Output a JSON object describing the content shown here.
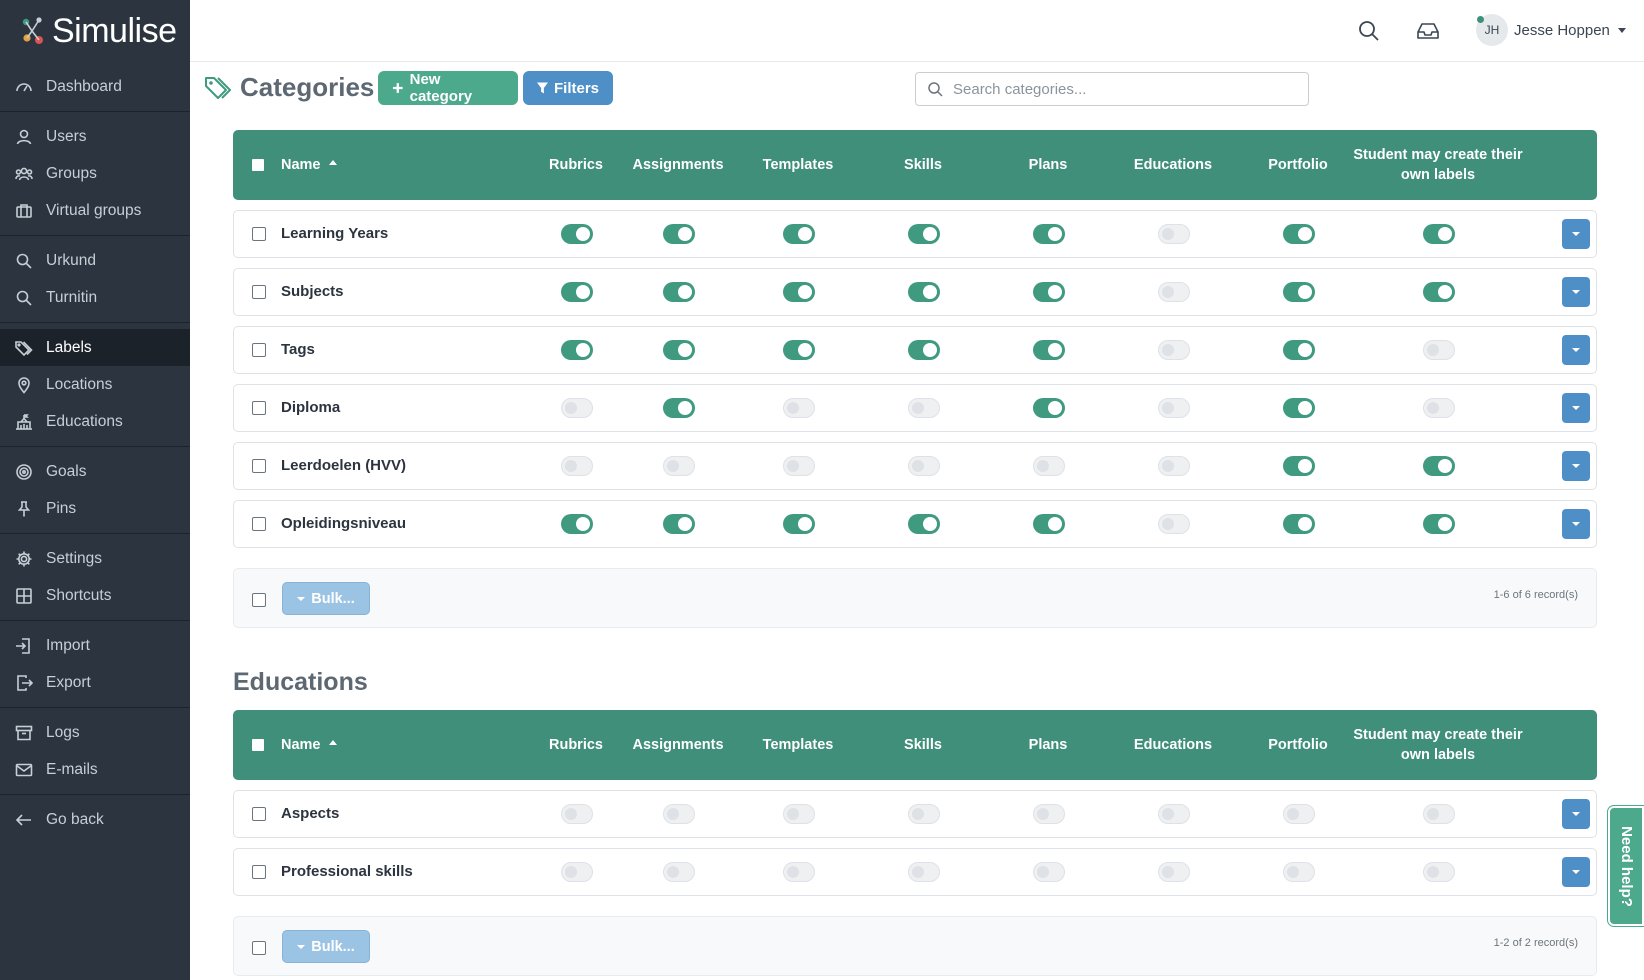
{
  "app": {
    "name": "Simulise"
  },
  "sidebar": {
    "groups": [
      [
        {
          "label": "Dashboard",
          "icon": "dashboard-icon"
        }
      ],
      [
        {
          "label": "Users",
          "icon": "user-icon"
        },
        {
          "label": "Groups",
          "icon": "groups-icon"
        },
        {
          "label": "Virtual groups",
          "icon": "briefcase-icon"
        }
      ],
      [
        {
          "label": "Urkund",
          "icon": "search-icon"
        },
        {
          "label": "Turnitin",
          "icon": "search-icon"
        }
      ],
      [
        {
          "label": "Labels",
          "icon": "tags-icon",
          "active": true
        },
        {
          "label": "Locations",
          "icon": "map-pin-icon"
        },
        {
          "label": "Educations",
          "icon": "school-icon"
        }
      ],
      [
        {
          "label": "Goals",
          "icon": "target-icon"
        },
        {
          "label": "Pins",
          "icon": "thumbtack-icon"
        }
      ],
      [
        {
          "label": "Settings",
          "icon": "gear-icon"
        },
        {
          "label": "Shortcuts",
          "icon": "grid-icon"
        }
      ],
      [
        {
          "label": "Import",
          "icon": "import-icon"
        },
        {
          "label": "Export",
          "icon": "export-icon"
        }
      ],
      [
        {
          "label": "Logs",
          "icon": "archive-icon"
        },
        {
          "label": "E-mails",
          "icon": "envelope-icon"
        }
      ],
      [
        {
          "label": "Go back",
          "icon": "arrow-left-icon"
        }
      ]
    ]
  },
  "topbar": {
    "user_initials": "JH",
    "user_name": "Jesse Hoppen"
  },
  "header": {
    "title": "Categories",
    "separator": "·",
    "new_button": "New category",
    "filters_button": "Filters",
    "search_placeholder": "Search categories..."
  },
  "columns": [
    "Name",
    "Rubrics",
    "Assignments",
    "Templates",
    "Skills",
    "Plans",
    "Educations",
    "Portfolio",
    "Student may create their own labels"
  ],
  "tables": [
    {
      "title": "",
      "rows": [
        {
          "name": "Learning Years",
          "toggles": [
            true,
            true,
            true,
            true,
            true,
            false,
            true,
            true
          ]
        },
        {
          "name": "Subjects",
          "toggles": [
            true,
            true,
            true,
            true,
            true,
            false,
            true,
            true
          ]
        },
        {
          "name": "Tags",
          "toggles": [
            true,
            true,
            true,
            true,
            true,
            false,
            true,
            false
          ]
        },
        {
          "name": "Diploma",
          "toggles": [
            false,
            true,
            false,
            false,
            true,
            false,
            true,
            false
          ]
        },
        {
          "name": "Leerdoelen (HVV)",
          "toggles": [
            false,
            false,
            false,
            false,
            false,
            false,
            true,
            true
          ]
        },
        {
          "name": "Opleidingsniveau",
          "toggles": [
            true,
            true,
            true,
            true,
            true,
            false,
            true,
            true
          ]
        }
      ],
      "bulk_label": "Bulk...",
      "records": "1-6 of 6 record(s)"
    },
    {
      "title": "Educations",
      "rows": [
        {
          "name": "Aspects",
          "toggles": [
            false,
            false,
            false,
            false,
            false,
            false,
            false,
            false
          ]
        },
        {
          "name": "Professional skills",
          "toggles": [
            false,
            false,
            false,
            false,
            false,
            false,
            false,
            false
          ]
        }
      ],
      "bulk_label": "Bulk...",
      "records": "1-2 of 2 record(s)"
    }
  ],
  "help_tab": "Need help?",
  "colors": {
    "sidebar": "#2c3440",
    "table_header": "#3f8f7a",
    "primary_green": "#4da98c",
    "primary_blue": "#4e8fc7"
  }
}
